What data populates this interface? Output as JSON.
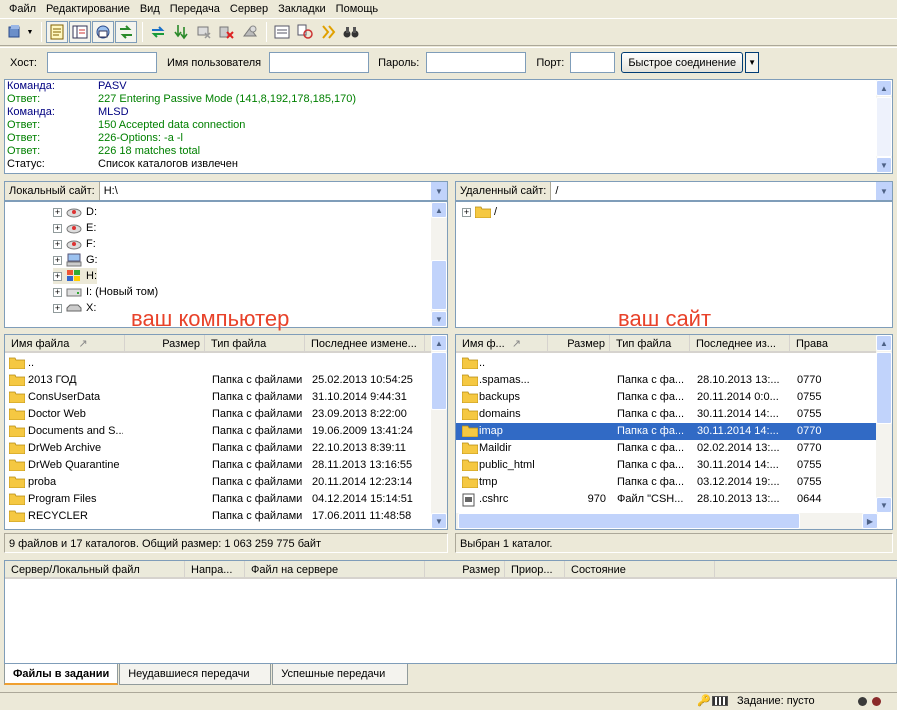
{
  "menu": [
    "Файл",
    "Редактирование",
    "Вид",
    "Передача",
    "Сервер",
    "Закладки",
    "Помощь"
  ],
  "quickconnect": {
    "host_label": "Хост:",
    "user_label": "Имя пользователя",
    "pass_label": "Пароль:",
    "port_label": "Порт:",
    "host": "",
    "user": "",
    "pass": "",
    "port": "",
    "connect_label": "Быстрое соединение"
  },
  "log": [
    {
      "k": "Команда:",
      "v": "PASV",
      "c": "navy"
    },
    {
      "k": "Ответ:",
      "v": "227 Entering Passive Mode (141,8,192,178,185,170)",
      "c": "green"
    },
    {
      "k": "Команда:",
      "v": "MLSD",
      "c": "navy"
    },
    {
      "k": "Ответ:",
      "v": "150 Accepted data connection",
      "c": "green"
    },
    {
      "k": "Ответ:",
      "v": "226-Options: -a -l",
      "c": "green"
    },
    {
      "k": "Ответ:",
      "v": "226 18 matches total",
      "c": "green"
    },
    {
      "k": "Статус:",
      "v": "Список каталогов извлечен",
      "c": "black"
    }
  ],
  "local": {
    "site_label": "Локальный сайт:",
    "path": "H:\\",
    "tree": [
      {
        "label": "D:",
        "icon": "cd-drive-icon"
      },
      {
        "label": "E:",
        "icon": "cd-drive-icon"
      },
      {
        "label": "F:",
        "icon": "cd-drive-icon"
      },
      {
        "label": "G:",
        "icon": "network-drive-icon"
      },
      {
        "label": "H:",
        "icon": "windows-drive-icon"
      },
      {
        "label": "I: (Новый том)",
        "icon": "hard-drive-icon"
      },
      {
        "label": "X:",
        "icon": "removable-drive-icon"
      }
    ],
    "annotation": "ваш компьютер",
    "columns": [
      "Имя файла",
      "Размер",
      "Тип файла",
      "Последнее измене..."
    ],
    "files": [
      {
        "name": "..",
        "size": "",
        "type": "",
        "modified": ""
      },
      {
        "name": "2013 ГОД",
        "size": "",
        "type": "Папка с файлами",
        "modified": "25.02.2013 10:54:25"
      },
      {
        "name": "ConsUserData",
        "size": "",
        "type": "Папка с файлами",
        "modified": "31.10.2014 9:44:31"
      },
      {
        "name": "Doctor Web",
        "size": "",
        "type": "Папка с файлами",
        "modified": "23.09.2013 8:22:00"
      },
      {
        "name": "Documents and S...",
        "size": "",
        "type": "Папка с файлами",
        "modified": "19.06.2009 13:41:24"
      },
      {
        "name": "DrWeb Archive",
        "size": "",
        "type": "Папка с файлами",
        "modified": "22.10.2013 8:39:11"
      },
      {
        "name": "DrWeb Quarantine",
        "size": "",
        "type": "Папка с файлами",
        "modified": "28.11.2013 13:16:55"
      },
      {
        "name": "proba",
        "size": "",
        "type": "Папка с файлами",
        "modified": "20.11.2014 12:23:14"
      },
      {
        "name": "Program Files",
        "size": "",
        "type": "Папка с файлами",
        "modified": "04.12.2014 15:14:51"
      },
      {
        "name": "RECYCLER",
        "size": "",
        "type": "Папка с файлами",
        "modified": "17.06.2011 11:48:58"
      }
    ],
    "status": "9 файлов и 17 каталогов. Общий размер: 1 063 259 775 байт"
  },
  "remote": {
    "site_label": "Удаленный сайт:",
    "path": "/",
    "tree_root": "/",
    "annotation": "ваш сайт",
    "columns": [
      "Имя ф...",
      "Размер",
      "Тип файла",
      "Последнее из...",
      "Права"
    ],
    "files": [
      {
        "name": "..",
        "size": "",
        "type": "",
        "modified": "",
        "perm": "",
        "icon": "folder"
      },
      {
        "name": ".spamas...",
        "size": "",
        "type": "Папка с фа...",
        "modified": "28.10.2013 13:...",
        "perm": "0770",
        "icon": "folder"
      },
      {
        "name": "backups",
        "size": "",
        "type": "Папка с фа...",
        "modified": "20.11.2014 0:0...",
        "perm": "0755",
        "icon": "folder"
      },
      {
        "name": "domains",
        "size": "",
        "type": "Папка с фа...",
        "modified": "30.11.2014 14:...",
        "perm": "0755",
        "icon": "folder"
      },
      {
        "name": "imap",
        "size": "",
        "type": "Папка с фа...",
        "modified": "30.11.2014 14:...",
        "perm": "0770",
        "icon": "folder",
        "selected": true
      },
      {
        "name": "Maildir",
        "size": "",
        "type": "Папка с фа...",
        "modified": "02.02.2014 13:...",
        "perm": "0770",
        "icon": "folder"
      },
      {
        "name": "public_html",
        "size": "",
        "type": "Папка с фа...",
        "modified": "30.11.2014 14:...",
        "perm": "0755",
        "icon": "folder"
      },
      {
        "name": "tmp",
        "size": "",
        "type": "Папка с фа...",
        "modified": "03.12.2014 19:...",
        "perm": "0755",
        "icon": "folder"
      },
      {
        "name": ".cshrc",
        "size": "970",
        "type": "Файл \"CSH...",
        "modified": "28.10.2013 13:...",
        "perm": "0644",
        "icon": "file"
      }
    ],
    "status": "Выбран 1 каталог."
  },
  "queue": {
    "columns": [
      "Сервер/Локальный файл",
      "Напра...",
      "Файл на сервере",
      "Размер",
      "Приор...",
      "Состояние"
    ]
  },
  "tabs": [
    "Файлы в задании",
    "Неудавшиеся передачи",
    "Успешные передачи"
  ],
  "statusbar": {
    "queue": "Задание: пусто"
  }
}
